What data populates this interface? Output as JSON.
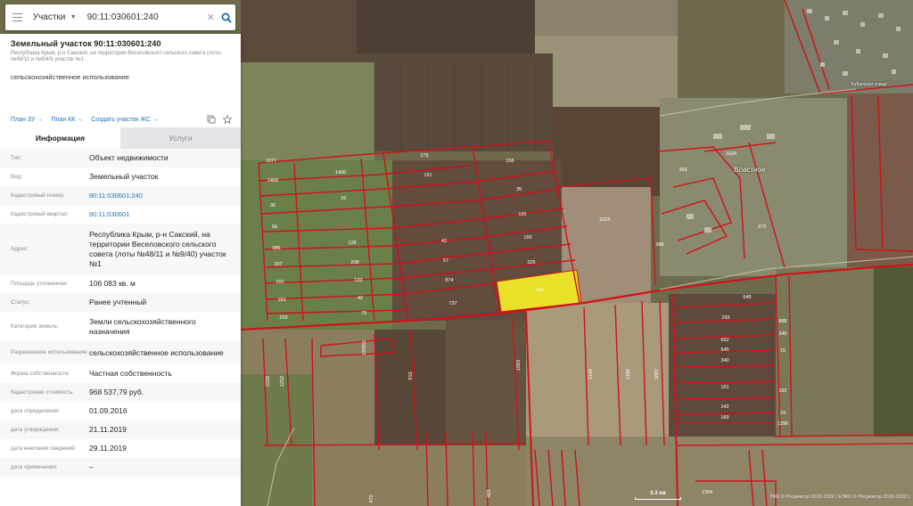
{
  "search": {
    "type_label": "Участки",
    "query": "90:11:030601:240"
  },
  "panel": {
    "title": "Земельный участок 90:11:030601:240",
    "subtitle": "Республика Крым, р-н Сакский, на территории Веселовского сельского совета (лоты №48/11 и №9/40) участок №1",
    "purpose": "сельскохозяйственное использование",
    "links": [
      "План ЗУ",
      "План КК",
      "Создать участок ЖС"
    ],
    "tabs": [
      "Информация",
      "Услуги"
    ],
    "rows": [
      {
        "label": "Тип:",
        "value": "Объект недвижимости"
      },
      {
        "label": "Вид:",
        "value": "Земельный участок"
      },
      {
        "label": "Кадастровый номер:",
        "value": "90:11:030601:240",
        "link": true
      },
      {
        "label": "Кадастровый квартал:",
        "value": "90:11:030601",
        "link": true
      },
      {
        "label": "Адрес:",
        "value": "Республика Крым, р-н Сакский, на территории Веселовского сельского совета (лоты №48/11 и №9/40) участок №1"
      },
      {
        "label": "Площадь уточненная:",
        "value": "106 083 кв. м"
      },
      {
        "label": "Статус:",
        "value": "Ранее учтенный"
      },
      {
        "label": "Категория земель:",
        "value": "Земли сельскохозяйственного назначения"
      },
      {
        "label": "Разрешенное использование:",
        "value": "сельскохозяйственное использование"
      },
      {
        "label": "Форма собственности:",
        "value": "Частная собственность"
      },
      {
        "label": "Кадастровая стоимость:",
        "value": "968 537,79 руб."
      },
      {
        "label": "дата определения:",
        "value": "01.09.2016"
      },
      {
        "label": "дата утверждения:",
        "value": "21.11.2019"
      },
      {
        "label": "дата внесения сведений:",
        "value": "29.11.2019"
      },
      {
        "label": "дата применения:",
        "value": "–"
      }
    ]
  },
  "map": {
    "place_name": "Властное",
    "street_label": "Кубанская улица",
    "scale_label": "0.3 км",
    "copyright": "ПКК © Росреестр 2010-2022 | ЕЭКО © Росреестр 2010-2022 |",
    "parcel_labels": [
      "1077",
      "1468",
      "36",
      "56",
      "986",
      "207",
      "201",
      "163",
      "203",
      "1400",
      "16",
      "128",
      "208",
      "133",
      "42",
      "79",
      "179",
      "191",
      "43",
      "57",
      "874",
      "737",
      "156",
      "35",
      "165",
      "166",
      "325",
      "240",
      "1023",
      "369",
      "1024",
      "272",
      "368",
      "649",
      "293",
      "888",
      "652",
      "645",
      "340",
      "345",
      "15",
      "151",
      "182",
      "142",
      "24",
      "169",
      "1396",
      "1394",
      "463",
      "472",
      "2269/1",
      "1083",
      "1134",
      "1186",
      "1087",
      "910",
      "2225",
      "1252"
    ],
    "colors": {
      "boundary": "#d0121b",
      "selected": "#e9e028"
    }
  },
  "icons": {
    "menu": "menu-icon",
    "search": "search-icon",
    "clear": "close-icon",
    "favorite": "star-icon",
    "copy": "copy-icon",
    "link_arrow": "arrow-right-icon"
  }
}
